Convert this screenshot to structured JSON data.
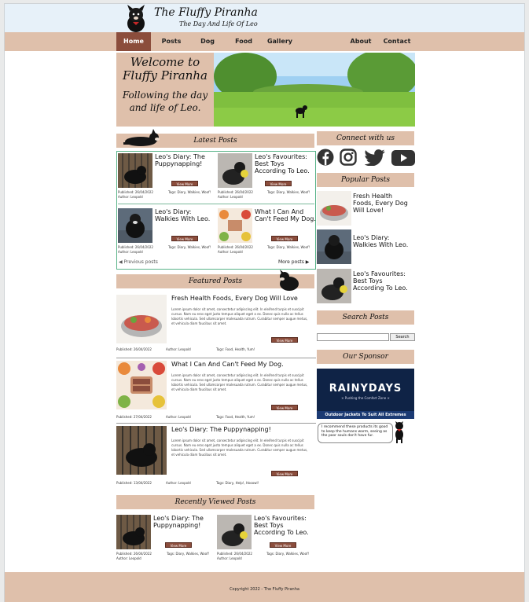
{
  "site": {
    "title": "The Fluffy Piranha",
    "tagline": "The Day And Life Of Leo"
  },
  "nav": {
    "items": [
      {
        "label": "Home",
        "active": true
      },
      {
        "label": "Posts"
      },
      {
        "label": "Dog Diary"
      },
      {
        "label": "Food"
      },
      {
        "label": "Gallery"
      },
      {
        "label": "About"
      },
      {
        "label": "Contact"
      }
    ]
  },
  "hero": {
    "title": "Welcome to Fluffy Piranha",
    "subtitle": "Following the day and life of Leo."
  },
  "latest": {
    "heading": "Latest Posts",
    "posts": [
      {
        "title": "Leo's Diary: The Puppynapping!",
        "button": "View More",
        "published": "Published: 26/04/2022",
        "author": "Author: Leopold",
        "tags": "Tags: Diary, Walkies, Woof!"
      },
      {
        "title": "Leo's Favourites: Best Toys According To Leo.",
        "button": "View More",
        "published": "Published: 26/04/2022",
        "author": "Author: Leopold",
        "tags": "Tags: Diary, Walkies, Woof!"
      },
      {
        "title": "Leo's Diary: Walkies With Leo.",
        "button": "View More",
        "published": "Published: 26/04/2022",
        "author": "Author: Leopold",
        "tags": "Tags: Diary, Walkies, Woof!"
      },
      {
        "title": "What I Can And Can't Feed My Dog.",
        "button": "View More",
        "published": "Published: 26/04/2022",
        "author": "Author: Leopold",
        "tags": "Tags: Diary, Walkies, Woof!"
      }
    ],
    "previous": "Previous posts",
    "more": "More posts"
  },
  "featured": {
    "heading": "Featured Posts",
    "posts": [
      {
        "title": "Fresh Health Foods, Every Dog Will Love",
        "excerpt": "Lorem ipsum dolor sit amet, consectetur adipiscing elit. In eleifend turpis et suscipit cursus. Nam eu eros eget justo tempus aliquet eget a ex. Donec quis nulla ac tellus lobortis vehicula. Sed ullamcorper malesuada rutrum. Curabitur semper augue metus, et vehicula diam faucibus sit amet.",
        "button": "View More",
        "published": "Published: 26/04/2022",
        "author": "Author: Leopold",
        "tags": "Tags: Food, Health, Yum!"
      },
      {
        "title": "What I Can And Can't Feed My Dog.",
        "excerpt": "Lorem ipsum dolor sit amet, consectetur adipiscing elit. In eleifend turpis et suscipit cursus. Nam eu eros eget justo tempus aliquet eget a ex. Donec quis nulla ac tellus lobortis vehicula. Sed ullamcorper malesuada rutrum. Curabitur semper augue metus, et vehicula diam faucibus sit amet.",
        "button": "View More",
        "published": "Published: 27/04/2022",
        "author": "Author: Leopold",
        "tags": "Tags: Food, Health, Yum!"
      },
      {
        "title": "Leo's Diary: The Puppynapping!",
        "excerpt": "Lorem ipsum dolor sit amet, consectetur adipiscing elit. In eleifend turpis et suscipit cursus. Nam eu eros eget justo tempus aliquet eget a ex. Donec quis nulla ac tellus lobortis vehicula. Sed ullamcorper malesuada rutrum. Curabitur semper augue metus, et vehicula diam faucibus sit amet.",
        "button": "View More",
        "published": "Published: 13/04/2022",
        "author": "Author: Leopold",
        "tags": "Tags: Diary, Help!, Hooowl!"
      }
    ]
  },
  "recent": {
    "heading": "Recently Viewed Posts",
    "posts": [
      {
        "title": "Leo's Diary: The Puppynapping!",
        "button": "View More",
        "published": "Published: 26/04/2022",
        "author": "Author: Leopold",
        "tags": "Tags: Diary, Walkies, Woof!"
      },
      {
        "title": "Leo's Favourites: Best Toys According To Leo.",
        "button": "View More",
        "published": "Published: 26/04/2022",
        "author": "Author: Leopold",
        "tags": "Tags: Diary, Walkies, Woof!"
      }
    ]
  },
  "sidebar": {
    "connect_heading": "Connect with us",
    "social": [
      "facebook-icon",
      "instagram-icon",
      "twitter-icon",
      "youtube-icon"
    ],
    "popular_heading": "Popular Posts",
    "popular": [
      {
        "title": "Fresh Health Foods, Every Dog Will Love!"
      },
      {
        "title": "Leo's Diary: Walkies With Leo."
      },
      {
        "title": "Leo's Favourites: Best Toys According To Leo."
      }
    ],
    "search_heading": "Search Posts",
    "search_button": "Search",
    "sponsor_heading": "Our Sponsor",
    "sponsor": {
      "name": "RAINYDAYS",
      "tagline": "× Pushing the Comfort Zone ×",
      "banner": "Outdoor Jackets To Suit All Extremes"
    },
    "speech": "I recommend these products its good to keep the humans warm, seeing as the poor souls don't have fur."
  },
  "footer": {
    "copyright": "Copyright 2022 - The Fluffy Piranha"
  },
  "colors": {
    "accent": "#8b4d3c",
    "band": "#dfc0ab",
    "header_bg": "#e7f1f9",
    "latest_border": "#58b388"
  }
}
